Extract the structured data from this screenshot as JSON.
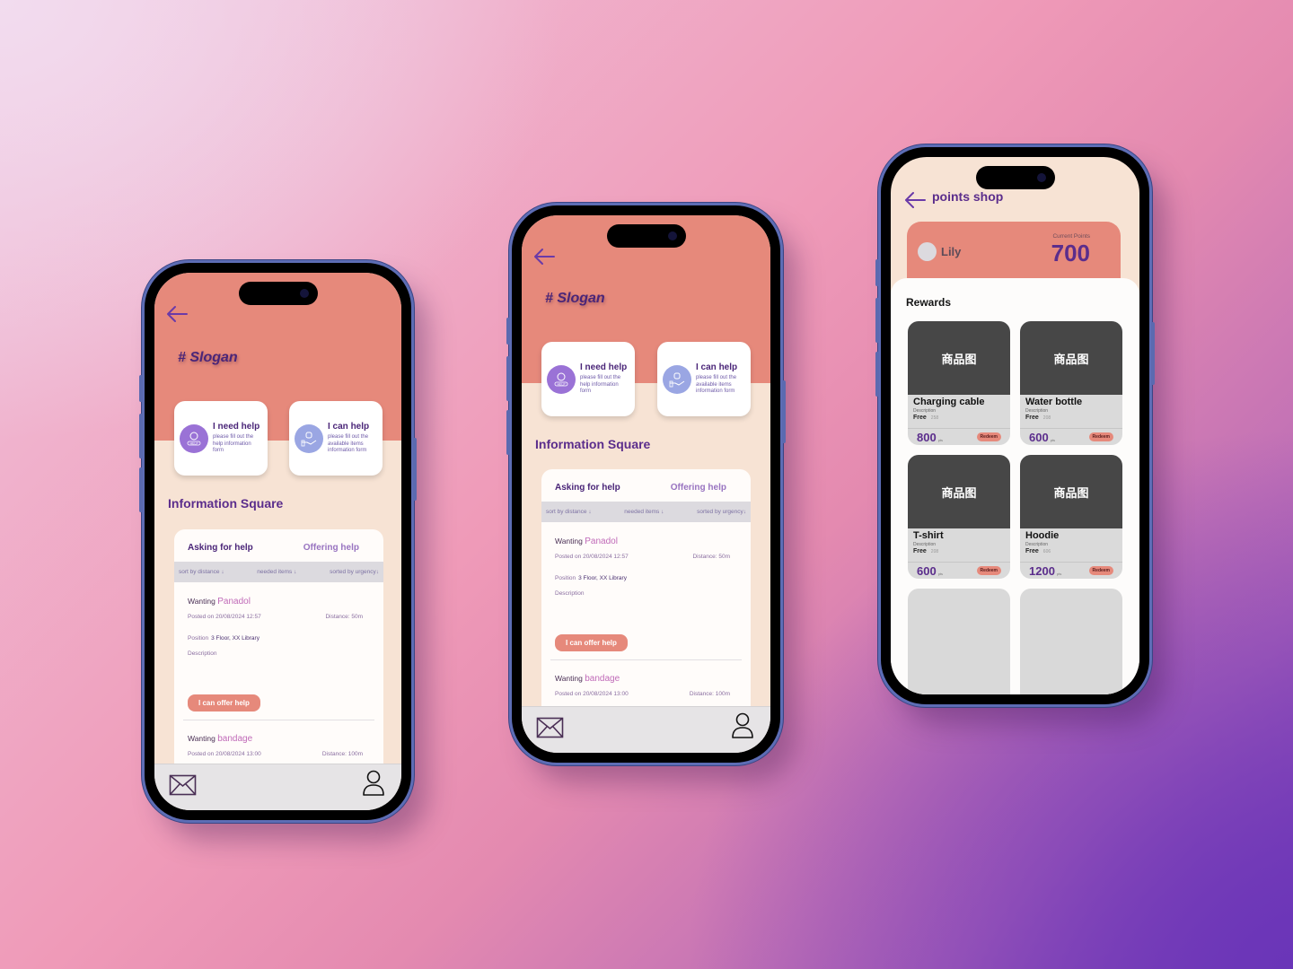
{
  "help_screen": {
    "slogan": "# Slogan",
    "need_help_card": {
      "title": "I need help",
      "subtitle": "please fill out the help information form"
    },
    "can_help_card": {
      "title": "I can help",
      "subtitle": "please fill out the available items information form"
    },
    "section_title": "Information Square",
    "tabs": {
      "asking": "Asking for help",
      "offering": "Offering help"
    },
    "sort_options": [
      "sort by distance ↓",
      "needed items ↓",
      "sorted by urgency↓"
    ],
    "posts": [
      {
        "prefix": "Wanting",
        "item": "Panadol",
        "posted": "Posted on 20/08/2024  12:57",
        "distance": "Distance: 50m",
        "position_label": "Position",
        "position": "3 Floor, XX Library",
        "description_label": "Description",
        "action": "I can offer help"
      },
      {
        "prefix": "Wanting",
        "item": "bandage",
        "posted": "Posted on 20/08/2024  13:00",
        "distance": "Distance: 100m"
      }
    ]
  },
  "shop_screen": {
    "title": "points shop",
    "user_name": "Lily",
    "points_label": "Current Points",
    "points_value": "700",
    "rewards_title": "Rewards",
    "rewards": [
      {
        "image_label": "商品图",
        "name": "Charging cable",
        "description": "Description",
        "free": "Free",
        "stock": "258",
        "points": "800",
        "unit": "pts",
        "action": "Redeem"
      },
      {
        "image_label": "商品图",
        "name": "Water bottle",
        "description": "Description",
        "free": "Free",
        "stock": "208",
        "points": "600",
        "unit": "pts",
        "action": "Redeem"
      },
      {
        "image_label": "商品图",
        "name": "T-shirt",
        "description": "Description",
        "free": "Free",
        "stock": "208",
        "points": "600",
        "unit": "pts",
        "action": "Redeem"
      },
      {
        "image_label": "商品图",
        "name": "Hoodie",
        "description": "Description",
        "free": "Free",
        "stock": "606",
        "points": "1200",
        "unit": "pts",
        "action": "Redeem"
      }
    ]
  },
  "colors": {
    "accent_coral": "#e6897b",
    "brand_purple": "#5b2d8c",
    "cream": "#f7e3d4"
  }
}
